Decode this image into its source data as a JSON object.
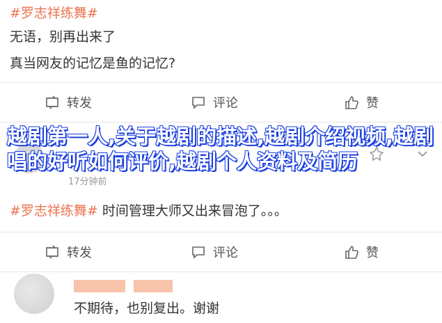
{
  "post1": {
    "tag": "#罗志祥练舞#",
    "line1": "无语，别再出来了",
    "line2": "真当网友的记忆是鱼的记忆?"
  },
  "actions": {
    "repost": "转发",
    "comment": "评论",
    "like": "赞"
  },
  "overlay": {
    "title": "越剧第一人,关于越剧的描述,越剧介绍视频,越剧唱的好听如何评价,越剧个人资料及简历"
  },
  "post2": {
    "meta": "17分钟前",
    "tag": "#罗志祥练舞#",
    "body": " 时间管理大师又出来冒泡了。。。"
  },
  "comment": {
    "text": "不期待，也别复出。谢谢"
  },
  "colors": {
    "tag": "#eb7350",
    "overlay_stroke": "#1a3fe0"
  }
}
